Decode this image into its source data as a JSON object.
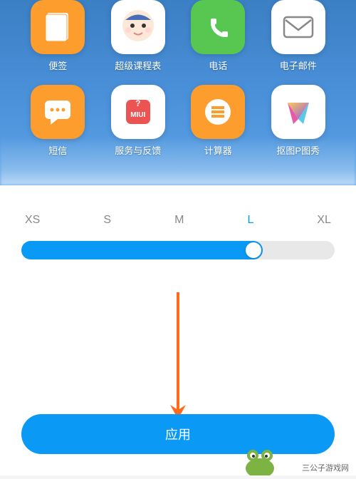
{
  "apps": {
    "row1": [
      {
        "label": "便签",
        "name": "notes"
      },
      {
        "label": "超级课程表",
        "name": "schedule"
      },
      {
        "label": "电话",
        "name": "phone"
      },
      {
        "label": "电子邮件",
        "name": "mail"
      }
    ],
    "row2": [
      {
        "label": "短信",
        "name": "sms"
      },
      {
        "label": "服务与反馈",
        "name": "feedback"
      },
      {
        "label": "计算器",
        "name": "calc"
      },
      {
        "label": "抠图P图秀",
        "name": "photo"
      }
    ]
  },
  "sizes": {
    "options": [
      "XS",
      "S",
      "M",
      "L",
      "XL"
    ],
    "selected": "L",
    "selected_index": 3
  },
  "apply_button": "应用",
  "watermark": "三公子游戏网",
  "miui_text": "MIUI",
  "colors": {
    "accent": "#0a9af5",
    "orange": "#fc9d2e",
    "green": "#58c752"
  }
}
